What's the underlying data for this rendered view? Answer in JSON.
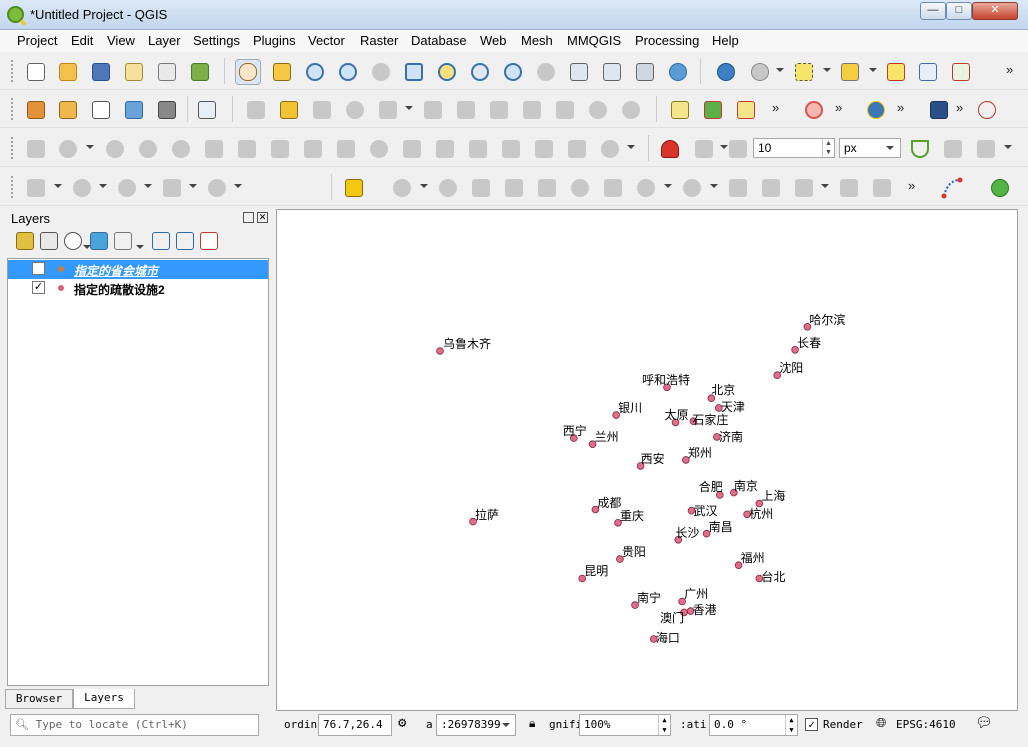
{
  "window": {
    "title": "*Untitled Project - QGIS",
    "minimize": "—",
    "maximize": "□",
    "close": "✕"
  },
  "menu": [
    "Project",
    "Edit",
    "View",
    "Layer",
    "Settings",
    "Plugins",
    "Vector",
    "Raster",
    "Database",
    "Web",
    "Mesh",
    "MMQGIS",
    "Processing",
    "Help"
  ],
  "toolbar": {
    "more": "»",
    "snap_tolerance": "10",
    "snap_units": "px"
  },
  "layers_panel": {
    "title": "Layers",
    "close": "✕",
    "layers": [
      {
        "name": "指定的省会城市",
        "checked": false,
        "selected": true,
        "symbol_color": "#c87f3a"
      },
      {
        "name": "指定的疏散设施2",
        "checked": true,
        "selected": false,
        "symbol_color": "#d9607c",
        "check_mark": "✓"
      }
    ]
  },
  "panel_tabs": [
    "Browser",
    "Layers"
  ],
  "map": {
    "point_color": "#e26d8a",
    "stroke_color": "#7a2b3d",
    "cities": [
      {
        "name": "乌鲁木齐",
        "lon": 87.6,
        "lat": 43.8
      },
      {
        "name": "哈尔滨",
        "lon": 126.6,
        "lat": 45.8
      },
      {
        "name": "长春",
        "lon": 125.3,
        "lat": 43.9
      },
      {
        "name": "沈阳",
        "lon": 123.4,
        "lat": 41.8
      },
      {
        "name": "呼和浩特",
        "lon": 111.7,
        "lat": 40.8
      },
      {
        "name": "北京",
        "lon": 116.4,
        "lat": 39.9
      },
      {
        "name": "天津",
        "lon": 117.2,
        "lat": 39.1
      },
      {
        "name": "银川",
        "lon": 106.3,
        "lat": 38.5
      },
      {
        "name": "太原",
        "lon": 112.6,
        "lat": 37.9
      },
      {
        "name": "石家庄",
        "lon": 114.5,
        "lat": 38.0
      },
      {
        "name": "济南",
        "lon": 117.0,
        "lat": 36.7
      },
      {
        "name": "西宁",
        "lon": 101.8,
        "lat": 36.6
      },
      {
        "name": "兰州",
        "lon": 103.8,
        "lat": 36.1
      },
      {
        "name": "西安",
        "lon": 108.9,
        "lat": 34.3
      },
      {
        "name": "郑州",
        "lon": 113.7,
        "lat": 34.8
      },
      {
        "name": "合肥",
        "lon": 117.3,
        "lat": 31.9
      },
      {
        "name": "南京",
        "lon": 118.8,
        "lat": 32.1
      },
      {
        "name": "上海",
        "lon": 121.5,
        "lat": 31.2
      },
      {
        "name": "成都",
        "lon": 104.1,
        "lat": 30.7
      },
      {
        "name": "武汉",
        "lon": 114.3,
        "lat": 30.6
      },
      {
        "name": "杭州",
        "lon": 120.2,
        "lat": 30.3
      },
      {
        "name": "重庆",
        "lon": 106.5,
        "lat": 29.6
      },
      {
        "name": "拉萨",
        "lon": 91.1,
        "lat": 29.7
      },
      {
        "name": "长沙",
        "lon": 112.9,
        "lat": 28.2
      },
      {
        "name": "南昌",
        "lon": 115.9,
        "lat": 28.7
      },
      {
        "name": "贵阳",
        "lon": 106.7,
        "lat": 26.6
      },
      {
        "name": "福州",
        "lon": 119.3,
        "lat": 26.1
      },
      {
        "name": "昆明",
        "lon": 102.7,
        "lat": 25.0
      },
      {
        "name": "台北",
        "lon": 121.5,
        "lat": 25.0
      },
      {
        "name": "广州",
        "lon": 113.3,
        "lat": 23.1
      },
      {
        "name": "南宁",
        "lon": 108.3,
        "lat": 22.8
      },
      {
        "name": "香港",
        "lon": 114.2,
        "lat": 22.3
      },
      {
        "name": "澳门",
        "lon": 113.5,
        "lat": 22.2
      },
      {
        "name": "海口",
        "lon": 110.3,
        "lat": 20.0
      }
    ]
  },
  "statusbar": {
    "locate_placeholder": "Type to locate (Ctrl+K)",
    "coordinate_label": "ordina",
    "coordinate_value": "76.7,26.4",
    "scale_label": "a",
    "scale_value": ":26978399",
    "magnifier_label": "gnifi",
    "magnifier_value": "100%",
    "rotation_label": ":ati",
    "rotation_value": "0.0 °",
    "render_label": "Render",
    "render_checked": "✓",
    "crs": "EPSG:4610"
  }
}
